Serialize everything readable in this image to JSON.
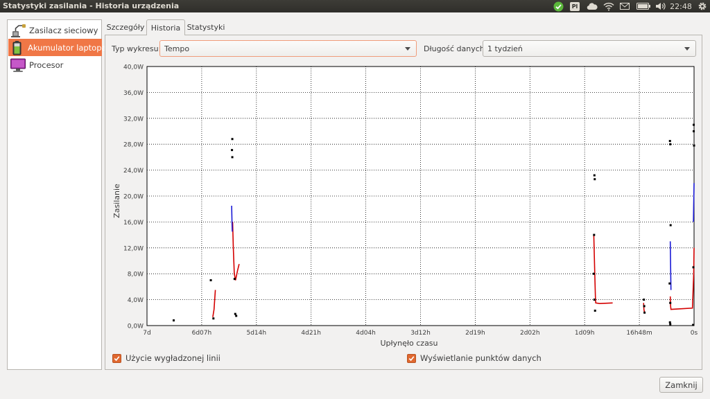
{
  "window": {
    "title": "Statystyki zasilania - Historia urządzenia"
  },
  "panel_tray": {
    "keyboard_layout": "Pl",
    "clock": "22:48",
    "icons": [
      "update-check-icon",
      "keyboard-layout-icon",
      "cloud-icon",
      "wifi-icon",
      "mail-icon",
      "battery-icon",
      "volume-icon",
      "gear-icon"
    ]
  },
  "sidebar": {
    "items": [
      {
        "label": "Zasilacz sieciowy",
        "icon": "ac-adapter-icon",
        "selected": false
      },
      {
        "label": "Akumulator laptopa",
        "icon": "battery-icon",
        "selected": true
      },
      {
        "label": "Procesor",
        "icon": "monitor-icon",
        "selected": false
      }
    ]
  },
  "tabs": [
    {
      "label": "Szczegóły",
      "active": false
    },
    {
      "label": "Historia",
      "active": true
    },
    {
      "label": "Statystyki",
      "active": false
    }
  ],
  "controls": {
    "graph_type_label": "Typ wykresu:",
    "graph_type_value": "Tempo",
    "data_length_label": "Długość danych:",
    "data_length_value": "1 tydzień"
  },
  "chart_data": {
    "type": "line",
    "xlabel": "Upłynęło czasu",
    "ylabel": "Zasilanie",
    "x_tick_labels": [
      "7d",
      "6d07h",
      "5d14h",
      "4d21h",
      "4d04h",
      "3d12h",
      "2d19h",
      "2d02h",
      "1d09h",
      "16h48m",
      "0s"
    ],
    "y_tick_labels": [
      "0,0W",
      "4,0W",
      "8,0W",
      "12,0W",
      "16,0W",
      "20,0W",
      "24,0W",
      "28,0W",
      "32,0W",
      "36,0W",
      "40,0W"
    ],
    "x_unit": "hours ago",
    "xlim": [
      168,
      0
    ],
    "ylim": [
      0,
      40
    ],
    "grid": true,
    "series": [
      {
        "color": "#d40000",
        "segments": [
          [
            [
              147.8,
              1.3
            ],
            [
              147.4,
              2.5
            ],
            [
              147.0,
              5.5
            ]
          ],
          [
            [
              141.7,
              16.0
            ],
            [
              141.5,
              12.0
            ],
            [
              141.2,
              8.0
            ],
            [
              140.8,
              7.0
            ],
            [
              140.2,
              8.5
            ],
            [
              139.7,
              9.5
            ]
          ],
          [
            [
              30.8,
              14.0
            ],
            [
              30.5,
              8.0
            ],
            [
              30.3,
              4.5
            ],
            [
              30.2,
              3.5
            ],
            [
              29.0,
              3.4
            ],
            [
              25.0,
              3.5
            ]
          ],
          [
            [
              15.5,
              3.5
            ],
            [
              15.4,
              2.5
            ],
            [
              15.2,
              2.0
            ]
          ],
          [
            [
              7.3,
              4.5
            ],
            [
              7.2,
              3.0
            ],
            [
              7.1,
              2.5
            ],
            [
              0.5,
              2.7
            ],
            [
              0.1,
              8.0
            ],
            [
              0.0,
              12.0
            ]
          ]
        ]
      },
      {
        "color": "#1a1ad6",
        "segments": [
          [
            [
              142.0,
              18.5
            ],
            [
              141.9,
              16.0
            ],
            [
              141.8,
              14.5
            ]
          ],
          [
            [
              7.3,
              13.0
            ],
            [
              7.2,
              9.0
            ],
            [
              7.1,
              5.5
            ]
          ],
          [
            [
              0.2,
              16.0
            ],
            [
              0.0,
              22.0
            ]
          ]
        ]
      },
      {
        "color": "#000000",
        "points": [
          [
            159.8,
            0.8
          ],
          [
            148.4,
            7.0
          ],
          [
            147.6,
            1.1
          ],
          [
            141.8,
            28.8
          ],
          [
            141.9,
            27.1
          ],
          [
            141.8,
            26.0
          ],
          [
            140.9,
            1.8
          ],
          [
            140.6,
            1.5
          ],
          [
            141.1,
            7.2
          ],
          [
            30.6,
            23.2
          ],
          [
            30.5,
            22.6
          ],
          [
            30.7,
            14.0
          ],
          [
            30.8,
            8.0
          ],
          [
            30.6,
            4.0
          ],
          [
            30.4,
            2.3
          ],
          [
            15.4,
            4.0
          ],
          [
            15.3,
            3.0
          ],
          [
            15.2,
            2.0
          ],
          [
            7.4,
            28.5
          ],
          [
            7.3,
            28.0
          ],
          [
            7.2,
            15.5
          ],
          [
            7.5,
            6.5
          ],
          [
            7.3,
            3.5
          ],
          [
            7.4,
            0.5
          ],
          [
            7.3,
            0.2
          ],
          [
            0.1,
            31.0
          ],
          [
            0.1,
            30.0
          ],
          [
            0.0,
            27.8
          ],
          [
            0.2,
            9.0
          ],
          [
            0.3,
            0.1
          ]
        ]
      }
    ]
  },
  "options": {
    "smooth_line_label": "Użycie wygładzonej linii",
    "smooth_line_checked": true,
    "show_points_label": "Wyświetlanie punktów danych",
    "show_points_checked": true
  },
  "buttons": {
    "close_label": "Zamknij"
  }
}
